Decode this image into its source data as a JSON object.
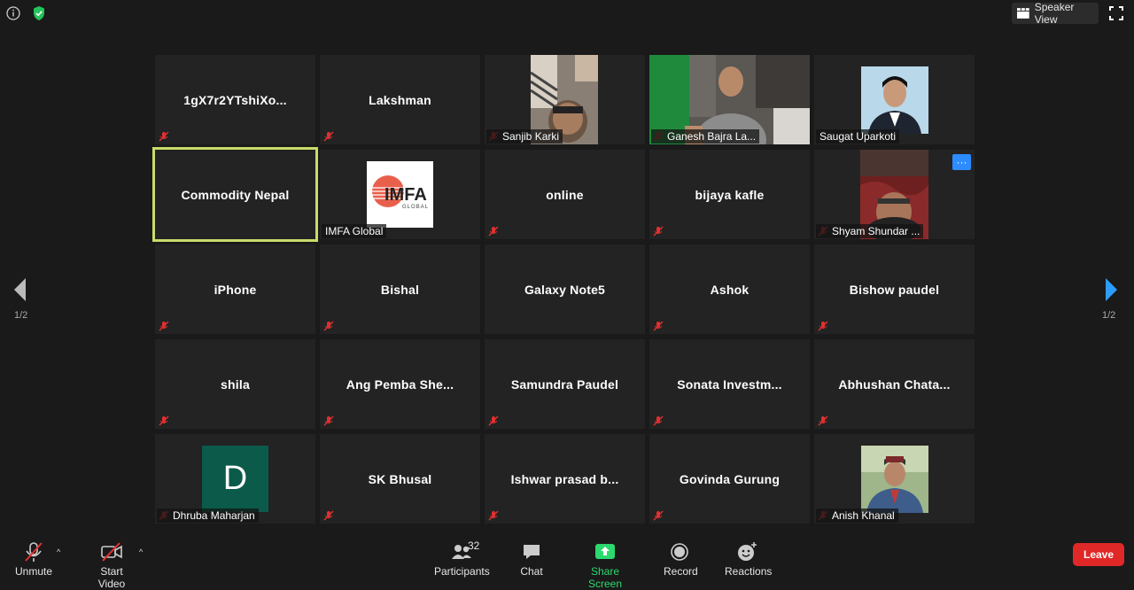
{
  "topbar": {
    "speaker_view_label": "Speaker View"
  },
  "pagination": {
    "left": "1/2",
    "right": "1/2"
  },
  "tiles": [
    {
      "name": "1gX7r2YTshiXo..."
    },
    {
      "name": "Lakshman"
    },
    {
      "label": "Sanjib Karki"
    },
    {
      "label": "Ganesh Bajra La..."
    },
    {
      "label": "Saugat Uparkoti"
    },
    {
      "name": "Commodity Nepal"
    },
    {
      "label": "IMFA Global",
      "logo_text": "IMFA",
      "logo_sub": "GLOBAL"
    },
    {
      "name": "online"
    },
    {
      "name": "bijaya kafle"
    },
    {
      "label": "Shyam Shundar ...",
      "more": "···"
    },
    {
      "name": "iPhone"
    },
    {
      "name": "Bishal"
    },
    {
      "name": "Galaxy Note5"
    },
    {
      "name": "Ashok"
    },
    {
      "name": "Bishow paudel"
    },
    {
      "name": "shila"
    },
    {
      "name": "Ang  Pemba She..."
    },
    {
      "name": "Samundra Paudel"
    },
    {
      "name": "Sonata  Investm..."
    },
    {
      "name": "Abhushan  Chata..."
    },
    {
      "label": "Dhruba Maharjan",
      "avatar_letter": "D"
    },
    {
      "name": "SK Bhusal"
    },
    {
      "name": "Ishwar prasad b..."
    },
    {
      "name": "Govinda Gurung"
    },
    {
      "label": "Anish Khanal"
    }
  ],
  "toolbar": {
    "unmute": "Unmute",
    "start_video": "Start Video",
    "participants": "Participants",
    "participants_count": "32",
    "chat": "Chat",
    "share_screen": "Share Screen",
    "record": "Record",
    "reactions": "Reactions",
    "leave": "Leave"
  },
  "colors": {
    "share_green": "#2bd96f",
    "leave_red": "#e02828",
    "active_border": "#c7dc6a",
    "accent_blue": "#2d8cff"
  }
}
